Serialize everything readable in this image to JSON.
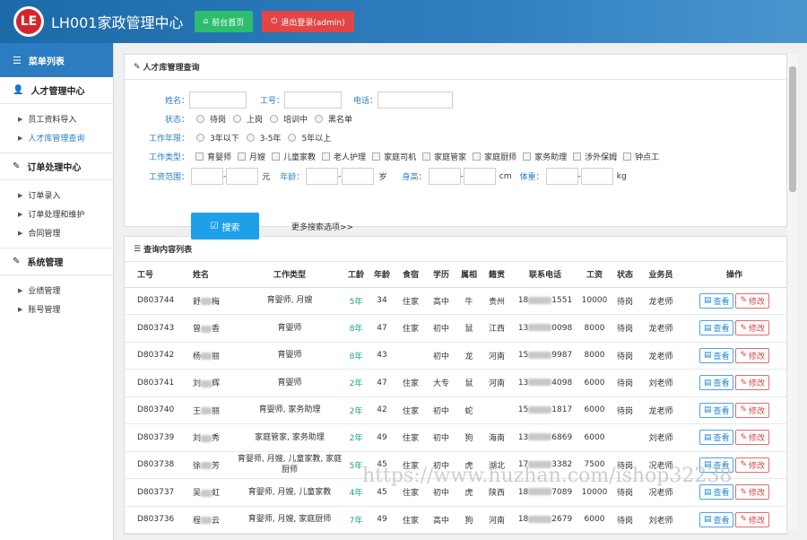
{
  "header": {
    "logo_text": "LE",
    "title": "LH001家政管理中心",
    "home_btn": "前台首页",
    "logout_btn": "退出登录(admin)"
  },
  "sidebar": {
    "menu_title": "菜单列表",
    "groups": [
      {
        "label": "人才管理中心",
        "items": [
          "员工资料导入",
          "人才库管理查询"
        ]
      },
      {
        "label": "订单处理中心",
        "items": [
          "订单录入",
          "订单处理和维护",
          "合同管理"
        ]
      },
      {
        "label": "系统管理",
        "items": [
          "业绩管理",
          "账号管理"
        ]
      }
    ]
  },
  "search": {
    "title": "人才库管理查询",
    "name_label": "姓名：",
    "id_label": "工号：",
    "phone_label": "电话：",
    "status_label": "状态：",
    "status_opts": [
      "待岗",
      "上岗",
      "培训中",
      "黑名单"
    ],
    "years_label": "工作年限：",
    "years_opts": [
      "3年以下",
      "3-5年",
      "5年以上"
    ],
    "type_label": "工作类型：",
    "type_opts": [
      "育婴师",
      "月嫂",
      "儿童家教",
      "老人护理",
      "家庭司机",
      "家庭管家",
      "家庭厨师",
      "家务助理",
      "涉外保姆",
      "钟点工"
    ],
    "wage_label": "工资范围：",
    "wage_unit": "元",
    "age_label": "年龄：",
    "age_unit": "岁",
    "height_label": "身高：",
    "height_unit": "cm",
    "weight_label": "体重：",
    "weight_unit": "kg",
    "dash": "-",
    "search_btn": "搜索",
    "more_link": "更多搜索选项>>"
  },
  "results": {
    "title": "查询内容列表",
    "columns": [
      "工号",
      "姓名",
      "工作类型",
      "工龄",
      "年龄",
      "食宿",
      "学历",
      "属相",
      "籍贯",
      "联系电话",
      "工资",
      "状态",
      "业务员",
      "操作"
    ],
    "view_btn": "查看",
    "edit_btn": "修改",
    "rows": [
      {
        "id": "D803744",
        "name1": "舒",
        "name2": "梅",
        "type": "育婴师, 月嫂",
        "years": "5年",
        "age": "34",
        "board": "住家",
        "edu": "高中",
        "zodiac": "牛",
        "origin": "贵州",
        "ph1": "18",
        "ph2": "1551",
        "wage": "10000",
        "status": "待岗",
        "agent": "龙老师"
      },
      {
        "id": "D803743",
        "name1": "曾",
        "name2": "香",
        "type": "育婴师",
        "years": "8年",
        "age": "47",
        "board": "住家",
        "edu": "初中",
        "zodiac": "鼠",
        "origin": "江西",
        "ph1": "13",
        "ph2": "0098",
        "wage": "8000",
        "status": "待岗",
        "agent": "龙老师"
      },
      {
        "id": "D803742",
        "name1": "杨",
        "name2": "丽",
        "type": "育婴师",
        "years": "8年",
        "age": "43",
        "board": "",
        "edu": "初中",
        "zodiac": "龙",
        "origin": "河南",
        "ph1": "15",
        "ph2": "9987",
        "wage": "8000",
        "status": "待岗",
        "agent": "龙老师"
      },
      {
        "id": "D803741",
        "name1": "刘",
        "name2": "辉",
        "type": "育婴师",
        "years": "2年",
        "age": "47",
        "board": "住家",
        "edu": "大专",
        "zodiac": "鼠",
        "origin": "河南",
        "ph1": "13",
        "ph2": "4098",
        "wage": "6000",
        "status": "待岗",
        "agent": "刘老师"
      },
      {
        "id": "D803740",
        "name1": "王",
        "name2": "丽",
        "type": "育婴师, 家务助理",
        "years": "2年",
        "age": "42",
        "board": "住家",
        "edu": "初中",
        "zodiac": "蛇",
        "origin": "",
        "ph1": "15",
        "ph2": "1817",
        "wage": "6000",
        "status": "待岗",
        "agent": "龙老师"
      },
      {
        "id": "D803739",
        "name1": "刘",
        "name2": "秀",
        "type": "家庭管家, 家务助理",
        "years": "2年",
        "age": "49",
        "board": "住家",
        "edu": "初中",
        "zodiac": "狗",
        "origin": "海南",
        "ph1": "13",
        "ph2": "6869",
        "wage": "6000",
        "status": "",
        "agent": "刘老师"
      },
      {
        "id": "D803738",
        "name1": "徐",
        "name2": "芳",
        "type": "育婴师, 月嫂, 儿童家教, 家庭厨师",
        "years": "5年",
        "age": "45",
        "board": "住家",
        "edu": "初中",
        "zodiac": "虎",
        "origin": "湖北",
        "ph1": "17",
        "ph2": "3382",
        "wage": "7500",
        "status": "待岗",
        "agent": "况老师"
      },
      {
        "id": "D803737",
        "name1": "吴",
        "name2": "虹",
        "type": "育婴师, 月嫂, 儿童家教",
        "years": "4年",
        "age": "45",
        "board": "住家",
        "edu": "初中",
        "zodiac": "虎",
        "origin": "陕西",
        "ph1": "18",
        "ph2": "7089",
        "wage": "10000",
        "status": "待岗",
        "agent": "况老师"
      },
      {
        "id": "D803736",
        "name1": "程",
        "name2": "云",
        "type": "育婴师, 月嫂, 家庭厨师",
        "years": "7年",
        "age": "49",
        "board": "住家",
        "edu": "高中",
        "zodiac": "狗",
        "origin": "河南",
        "ph1": "18",
        "ph2": "2679",
        "wage": "6000",
        "status": "待岗",
        "agent": "刘老师"
      }
    ]
  },
  "watermark": "https://www.huzhan.com/ishop32238"
}
